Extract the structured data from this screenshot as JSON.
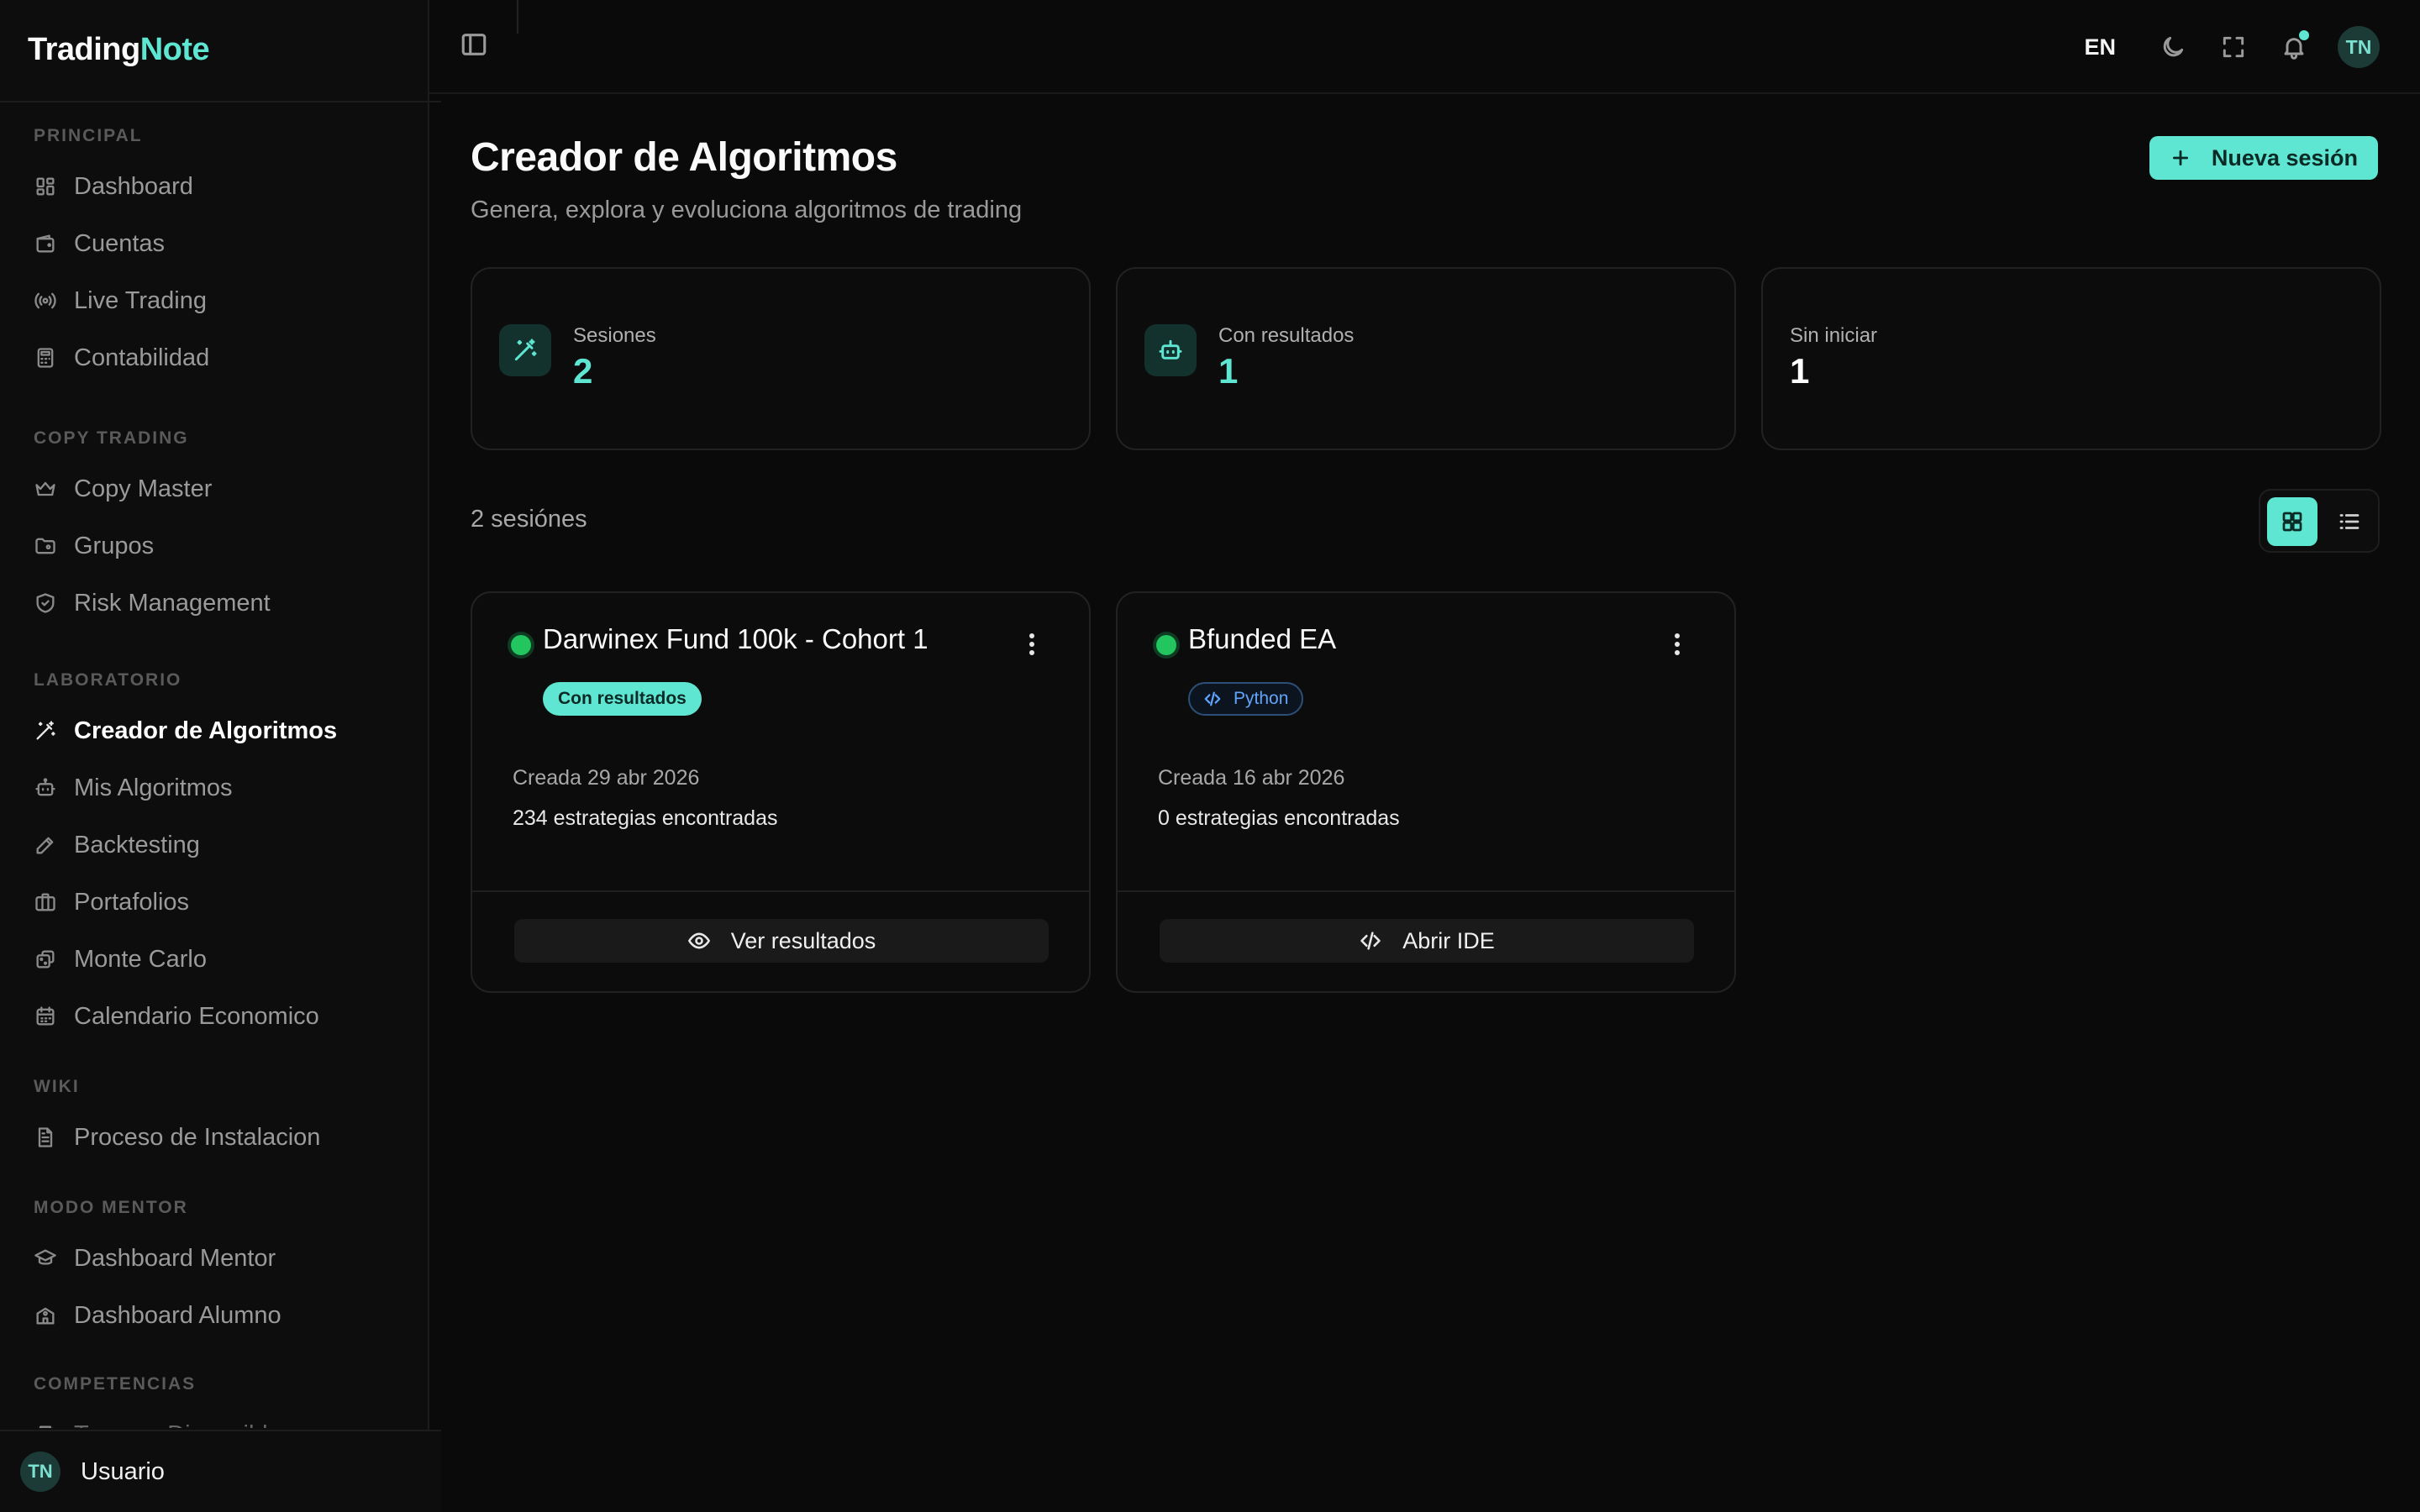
{
  "brand": {
    "part1": "Trading",
    "part2": "Note"
  },
  "sidebar": {
    "sections": [
      {
        "title": "PRINCIPAL",
        "items": [
          "Dashboard",
          "Cuentas",
          "Live Trading",
          "Contabilidad"
        ]
      },
      {
        "title": "COPY TRADING",
        "items": [
          "Copy Master",
          "Grupos",
          "Risk Management"
        ]
      },
      {
        "title": "LABORATORIO",
        "items": [
          "Creador de Algoritmos",
          "Mis Algoritmos",
          "Backtesting",
          "Portafolios",
          "Monte Carlo",
          "Calendario Economico"
        ]
      },
      {
        "title": "WIKI",
        "items": [
          "Proceso de Instalacion"
        ]
      },
      {
        "title": "MODO MENTOR",
        "items": [
          "Dashboard Mentor",
          "Dashboard Alumno"
        ]
      },
      {
        "title": "COMPETENCIAS",
        "items": [
          "Torneos Disponibles"
        ]
      }
    ],
    "active_item": "Creador de Algoritmos",
    "user": {
      "initials": "TN",
      "name": "Usuario"
    }
  },
  "topbar": {
    "language": "EN",
    "avatar_initials": "TN"
  },
  "page": {
    "title": "Creador de Algoritmos",
    "subtitle": "Genera, explora y evoluciona algoritmos de trading",
    "new_session_label": "Nueva sesión"
  },
  "stats": [
    {
      "label": "Sesiones",
      "value": "2",
      "icon": "wand-icon",
      "color": "#5ee6d2"
    },
    {
      "label": "Con resultados",
      "value": "1",
      "icon": "bot-icon",
      "color": "#5ee6d2"
    },
    {
      "label": "Sin iniciar",
      "value": "1",
      "icon": "",
      "color": "#ffffff"
    }
  ],
  "sessions_count_label": "2 sesiónes",
  "sessions": [
    {
      "title": "Darwinex Fund 100k - Cohort 1",
      "status_color": "#22c55e",
      "badge": "Con resultados",
      "badge_type": "results",
      "created": "Creada 29 abr 2026",
      "found": "234 estrategias encontradas",
      "action_label": "Ver resultados",
      "action_icon": "eye-icon"
    },
    {
      "title": "Bfunded EA",
      "status_color": "#22c55e",
      "badge": "Python",
      "badge_type": "python",
      "created": "Creada 16 abr 2026",
      "found": "0 estrategias encontradas",
      "action_label": "Abrir IDE",
      "action_icon": "code-icon"
    }
  ],
  "colors": {
    "accent": "#5ee6d2",
    "status_green": "#22c55e",
    "python_blue": "#60a5fa"
  }
}
